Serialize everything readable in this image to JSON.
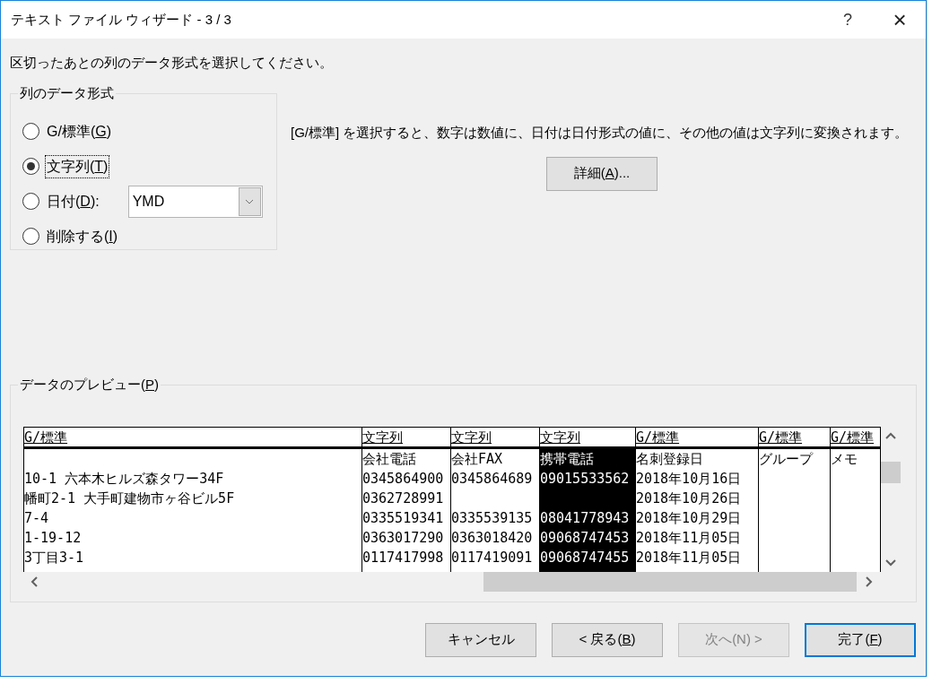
{
  "window": {
    "title": "テキスト ファイル ウィザード - 3 / 3",
    "help": "?",
    "close": "×"
  },
  "instruction": "区切ったあとの列のデータ形式を選択してください。",
  "format_group": {
    "title": "列のデータ形式",
    "options": [
      {
        "label": "G/標準(",
        "access_key": "G",
        "label_end": ")",
        "selected": false,
        "focused": false
      },
      {
        "label": "文字列(",
        "access_key": "T",
        "label_end": ")",
        "selected": true,
        "focused": true
      },
      {
        "label": "日付(",
        "access_key": "D",
        "label_end": "):",
        "selected": false,
        "focused": false,
        "dropdown": {
          "value": "YMD"
        }
      },
      {
        "label": "削除する(",
        "access_key": "I",
        "label_end": ")",
        "selected": false,
        "focused": false
      }
    ]
  },
  "description": "[G/標準] を選択すると、数字は数値に、日付は日付形式の値に、その他の値は文字列に変換されます。",
  "advanced_button": {
    "label": "詳細(",
    "access_key": "A",
    "label_end": ")..."
  },
  "preview": {
    "title": "データのプレビュー(",
    "access_key": "P",
    "title_end": ")",
    "columns": [
      {
        "format": "G/標準",
        "selected": false,
        "cells": [
          null,
          "10-1 六本木ヒルズ森タワー34F",
          "幡町2-1 大手町建物市ヶ谷ビル5F",
          "7-4",
          "1-19-12",
          "3丁目3-1"
        ]
      },
      {
        "format": "文字列",
        "selected": false,
        "cells": [
          "会社電話",
          "0345864900",
          "0362728991",
          "0335519341",
          "0363017290",
          "0117417998"
        ]
      },
      {
        "format": "文字列",
        "selected": false,
        "cells": [
          "会社FAX",
          "0345864689",
          null,
          "0335539135",
          "0363018420",
          "0117419091"
        ]
      },
      {
        "format": "文字列",
        "selected": true,
        "cells": [
          "携帯電話",
          "09015533562",
          null,
          "08041778943",
          "09068747453",
          "09068747455"
        ]
      },
      {
        "format": "G/標準",
        "selected": false,
        "cells": [
          "名刺登録日",
          "2018年10月16日",
          "2018年10月26日",
          "2018年10月29日",
          "2018年11月05日",
          "2018年11月05日"
        ]
      },
      {
        "format": "G/標準",
        "selected": false,
        "cells": [
          "グループ",
          null,
          null,
          null,
          null,
          null
        ]
      },
      {
        "format": "G/標準",
        "selected": false,
        "cells": [
          "メモ",
          null,
          null,
          null,
          null,
          null
        ]
      }
    ]
  },
  "buttons": [
    {
      "label": "キャンセル",
      "disabled": false,
      "default": false
    },
    {
      "label": "< 戻る(",
      "access_key": "B",
      "label_end": ")",
      "disabled": false,
      "default": false
    },
    {
      "label": "次へ(N) >",
      "disabled": true,
      "default": false
    },
    {
      "label": "完了(",
      "access_key": "F",
      "label_end": ")",
      "disabled": false,
      "default": true
    }
  ]
}
